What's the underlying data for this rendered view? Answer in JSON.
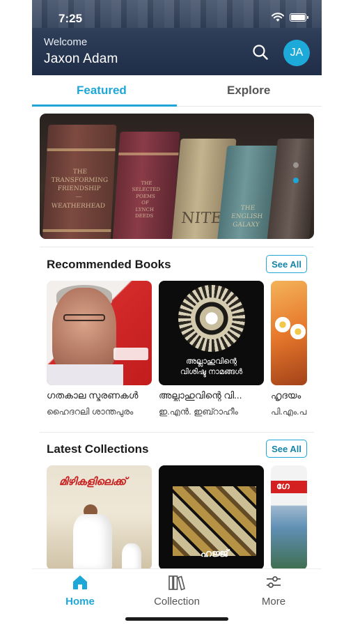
{
  "status_bar": {
    "time": "7:25"
  },
  "header": {
    "welcome": "Welcome",
    "user_name": "Jaxon Adam",
    "avatar_initials": "JA"
  },
  "tabs": [
    {
      "label": "Featured",
      "active": true
    },
    {
      "label": "Explore",
      "active": false
    }
  ],
  "banner": {
    "spine_1": "THE\nTRANSFORMING\nFRIENDSHIP\n—\nWEATHERHEAD",
    "spine_2": "THE\nSELECTED\nPOEMS\nOF\nLYNCH\nDEEDS",
    "spine_3": "NITE",
    "spine_4": "THE\nENGLISH\nGALAXY",
    "slide_count": 2,
    "active_slide": 1
  },
  "recommended": {
    "title": "Recommended Books",
    "see_all": "See All",
    "books": [
      {
        "title": "ഗതകാല സ്മരണകൾ",
        "author": "ഹൈദറലി ശാന്തപുരം"
      },
      {
        "title": "അല്ലാഹുവിന്റെ വി...",
        "author": "ഇ.എൻ. ഇബ്റാഹീം",
        "cover_caption": "അല്ലാഹുവിന്റെ\nവിശിഷ്ട നാമങ്ങൾ"
      },
      {
        "title": "ഹൃദയം",
        "author": "പി.എം.പ"
      }
    ]
  },
  "collections": {
    "title": "Latest Collections",
    "see_all": "See All",
    "items": [
      {
        "cover_text": "മിഴികളിലെക്ക്"
      },
      {
        "cover_text": "ഹജ്ജ്"
      },
      {
        "cover_text": "ഗേ"
      }
    ]
  },
  "bottom_nav": [
    {
      "label": "Home",
      "icon": "home-icon",
      "active": true
    },
    {
      "label": "Collection",
      "icon": "books-icon",
      "active": false
    },
    {
      "label": "More",
      "icon": "sliders-icon",
      "active": false
    }
  ],
  "colors": {
    "accent": "#1ea7d6",
    "header": "#2e3d57",
    "avatar": "#1eaad9"
  }
}
